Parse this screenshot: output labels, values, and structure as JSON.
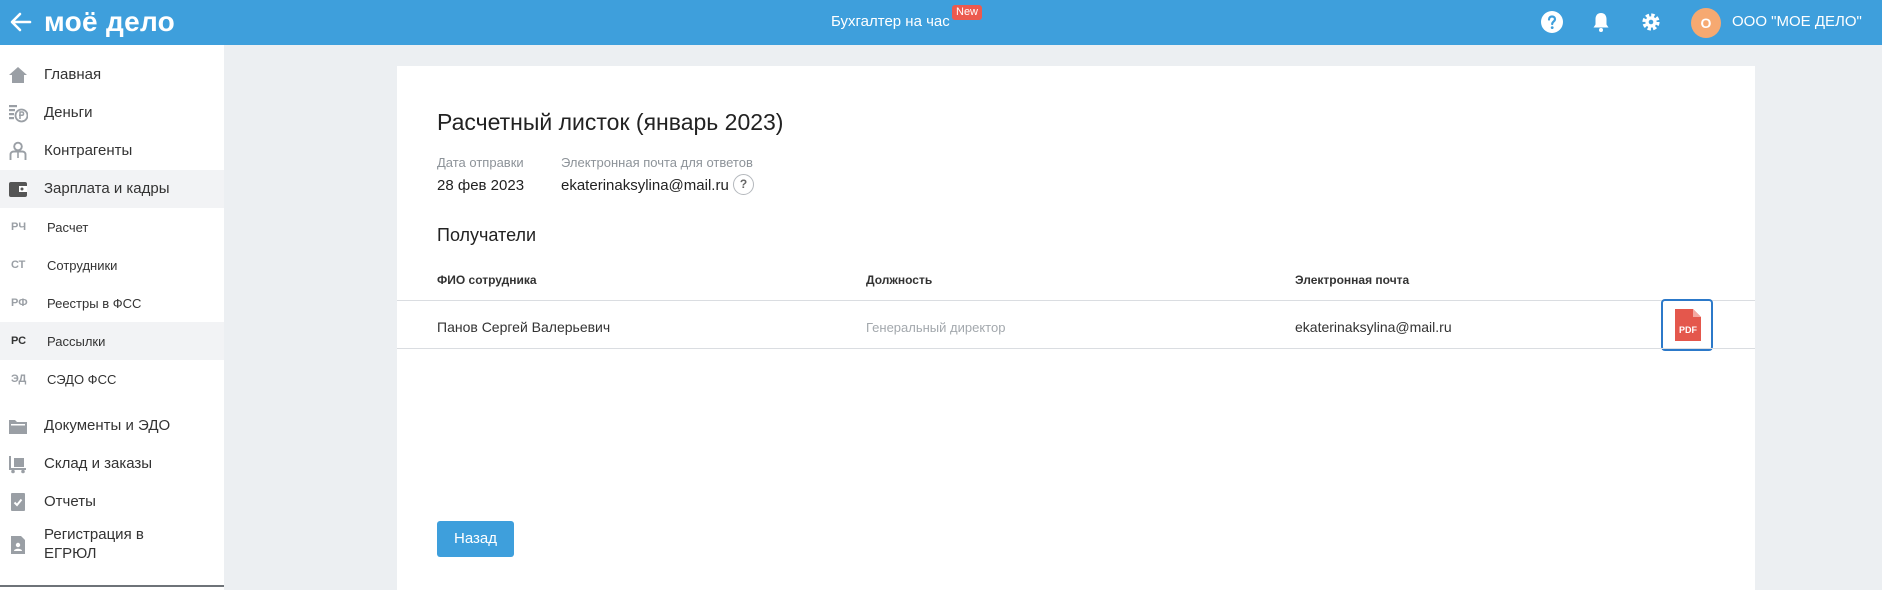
{
  "header": {
    "logo": "моё дело",
    "center_link": "Бухгалтер на час",
    "new_badge": "New",
    "avatar_letter": "О",
    "org_name": "ООО \"МОЕ ДЕЛО\"",
    "brand_color": "#3e9fdc",
    "icons": [
      "back-arrow-icon",
      "help-icon",
      "bell-icon",
      "gear-icon"
    ]
  },
  "sidebar": {
    "items": [
      {
        "label": "Главная",
        "icon": "home-icon"
      },
      {
        "label": "Деньги",
        "icon": "money-icon"
      },
      {
        "label": "Контрагенты",
        "icon": "contractors-icon"
      },
      {
        "label": "Зарплата и кадры",
        "icon": "wallet-icon"
      },
      {
        "label": "Документы и ЭДО",
        "icon": "folder-icon"
      },
      {
        "label": "Склад и заказы",
        "icon": "warehouse-icon"
      },
      {
        "label": "Отчеты",
        "icon": "report-icon"
      },
      {
        "label": "Регистрация в ЕГРЮЛ",
        "icon": "registration-icon"
      }
    ],
    "subitems": [
      {
        "abbr": "РЧ",
        "label": "Расчет"
      },
      {
        "abbr": "СТ",
        "label": "Сотрудники"
      },
      {
        "abbr": "РФ",
        "label": "Реестры в ФСС"
      },
      {
        "abbr": "РС",
        "label": "Рассылки"
      },
      {
        "abbr": "ЭД",
        "label": "СЭДО ФСС"
      }
    ]
  },
  "main": {
    "title": "Расчетный листок (январь 2023)",
    "sent_date_label": "Дата отправки",
    "sent_date": "28 фев 2023",
    "reply_email_label": "Электронная почта для ответов",
    "reply_email": "ekaterinaksylina@mail.ru",
    "help_symbol": "?",
    "recipients_title": "Получатели",
    "table": {
      "columns": [
        "ФИО сотрудника",
        "Должность",
        "Электронная почта"
      ],
      "rows": [
        {
          "name": "Панов Сергей Валерьевич",
          "position": "Генеральный директор",
          "email": "ekaterinaksylina@mail.ru",
          "file": "PDF"
        }
      ]
    },
    "back_button": "Назад"
  }
}
